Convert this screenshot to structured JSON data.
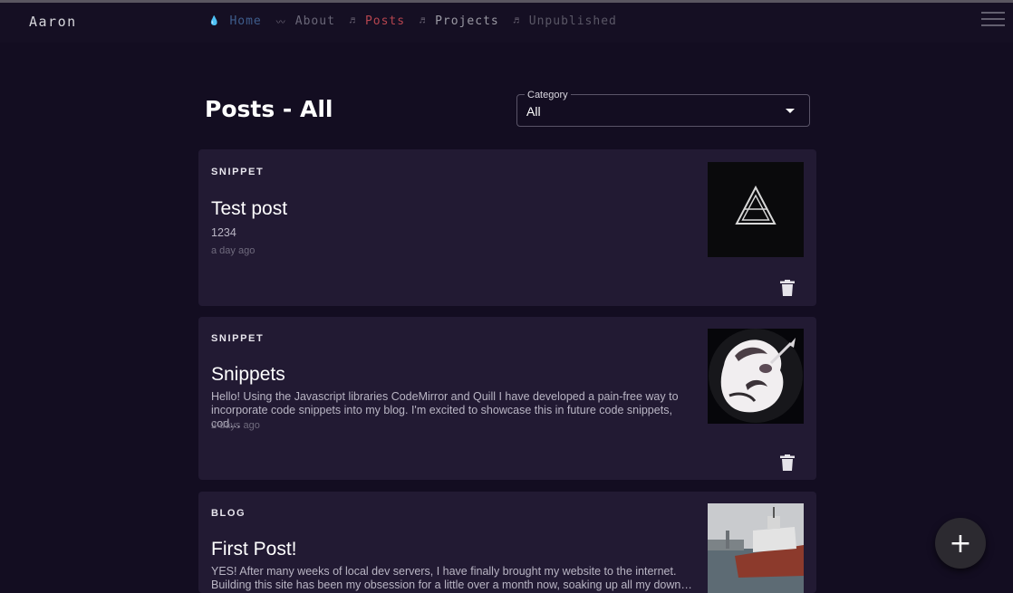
{
  "nav": {
    "brand": "Aaron",
    "links": [
      {
        "label": "Home",
        "icon": "drop-icon"
      },
      {
        "label": "About",
        "icon": "wave-icon"
      },
      {
        "label": "Posts",
        "icon": "music-note-icon"
      },
      {
        "label": "Projects",
        "icon": "music-note-icon"
      },
      {
        "label": "Unpublished",
        "icon": "music-note-icon"
      }
    ],
    "icon_glyphs": [
      "💧",
      "〰",
      "♬",
      "♬",
      "♬"
    ]
  },
  "page": {
    "title": "Posts - All",
    "category_label": "Category",
    "category_value": "All"
  },
  "posts": [
    {
      "category": "SNIPPET",
      "title": "Test post",
      "body": "1234",
      "time": "a day ago"
    },
    {
      "category": "SNIPPET",
      "title": "Snippets",
      "body": "Hello! Using the Javascript libraries CodeMirror and Quill I have developed a pain-free way to incorporate code snippets into my blog. I'm excited to showcase this in future code snippets, cod…",
      "time": "2 days ago"
    },
    {
      "category": "BLOG",
      "title": "First Post!",
      "body": "YES! After many weeks of local dev servers, I have finally brought my website to the internet. Building this site has been my obsession for a little over a month now, soaking up all my down…",
      "time": ""
    }
  ],
  "fab_label": "+",
  "colors": {
    "background": "#130d21",
    "card": "#221a33",
    "posts_active": "#b6454f"
  }
}
